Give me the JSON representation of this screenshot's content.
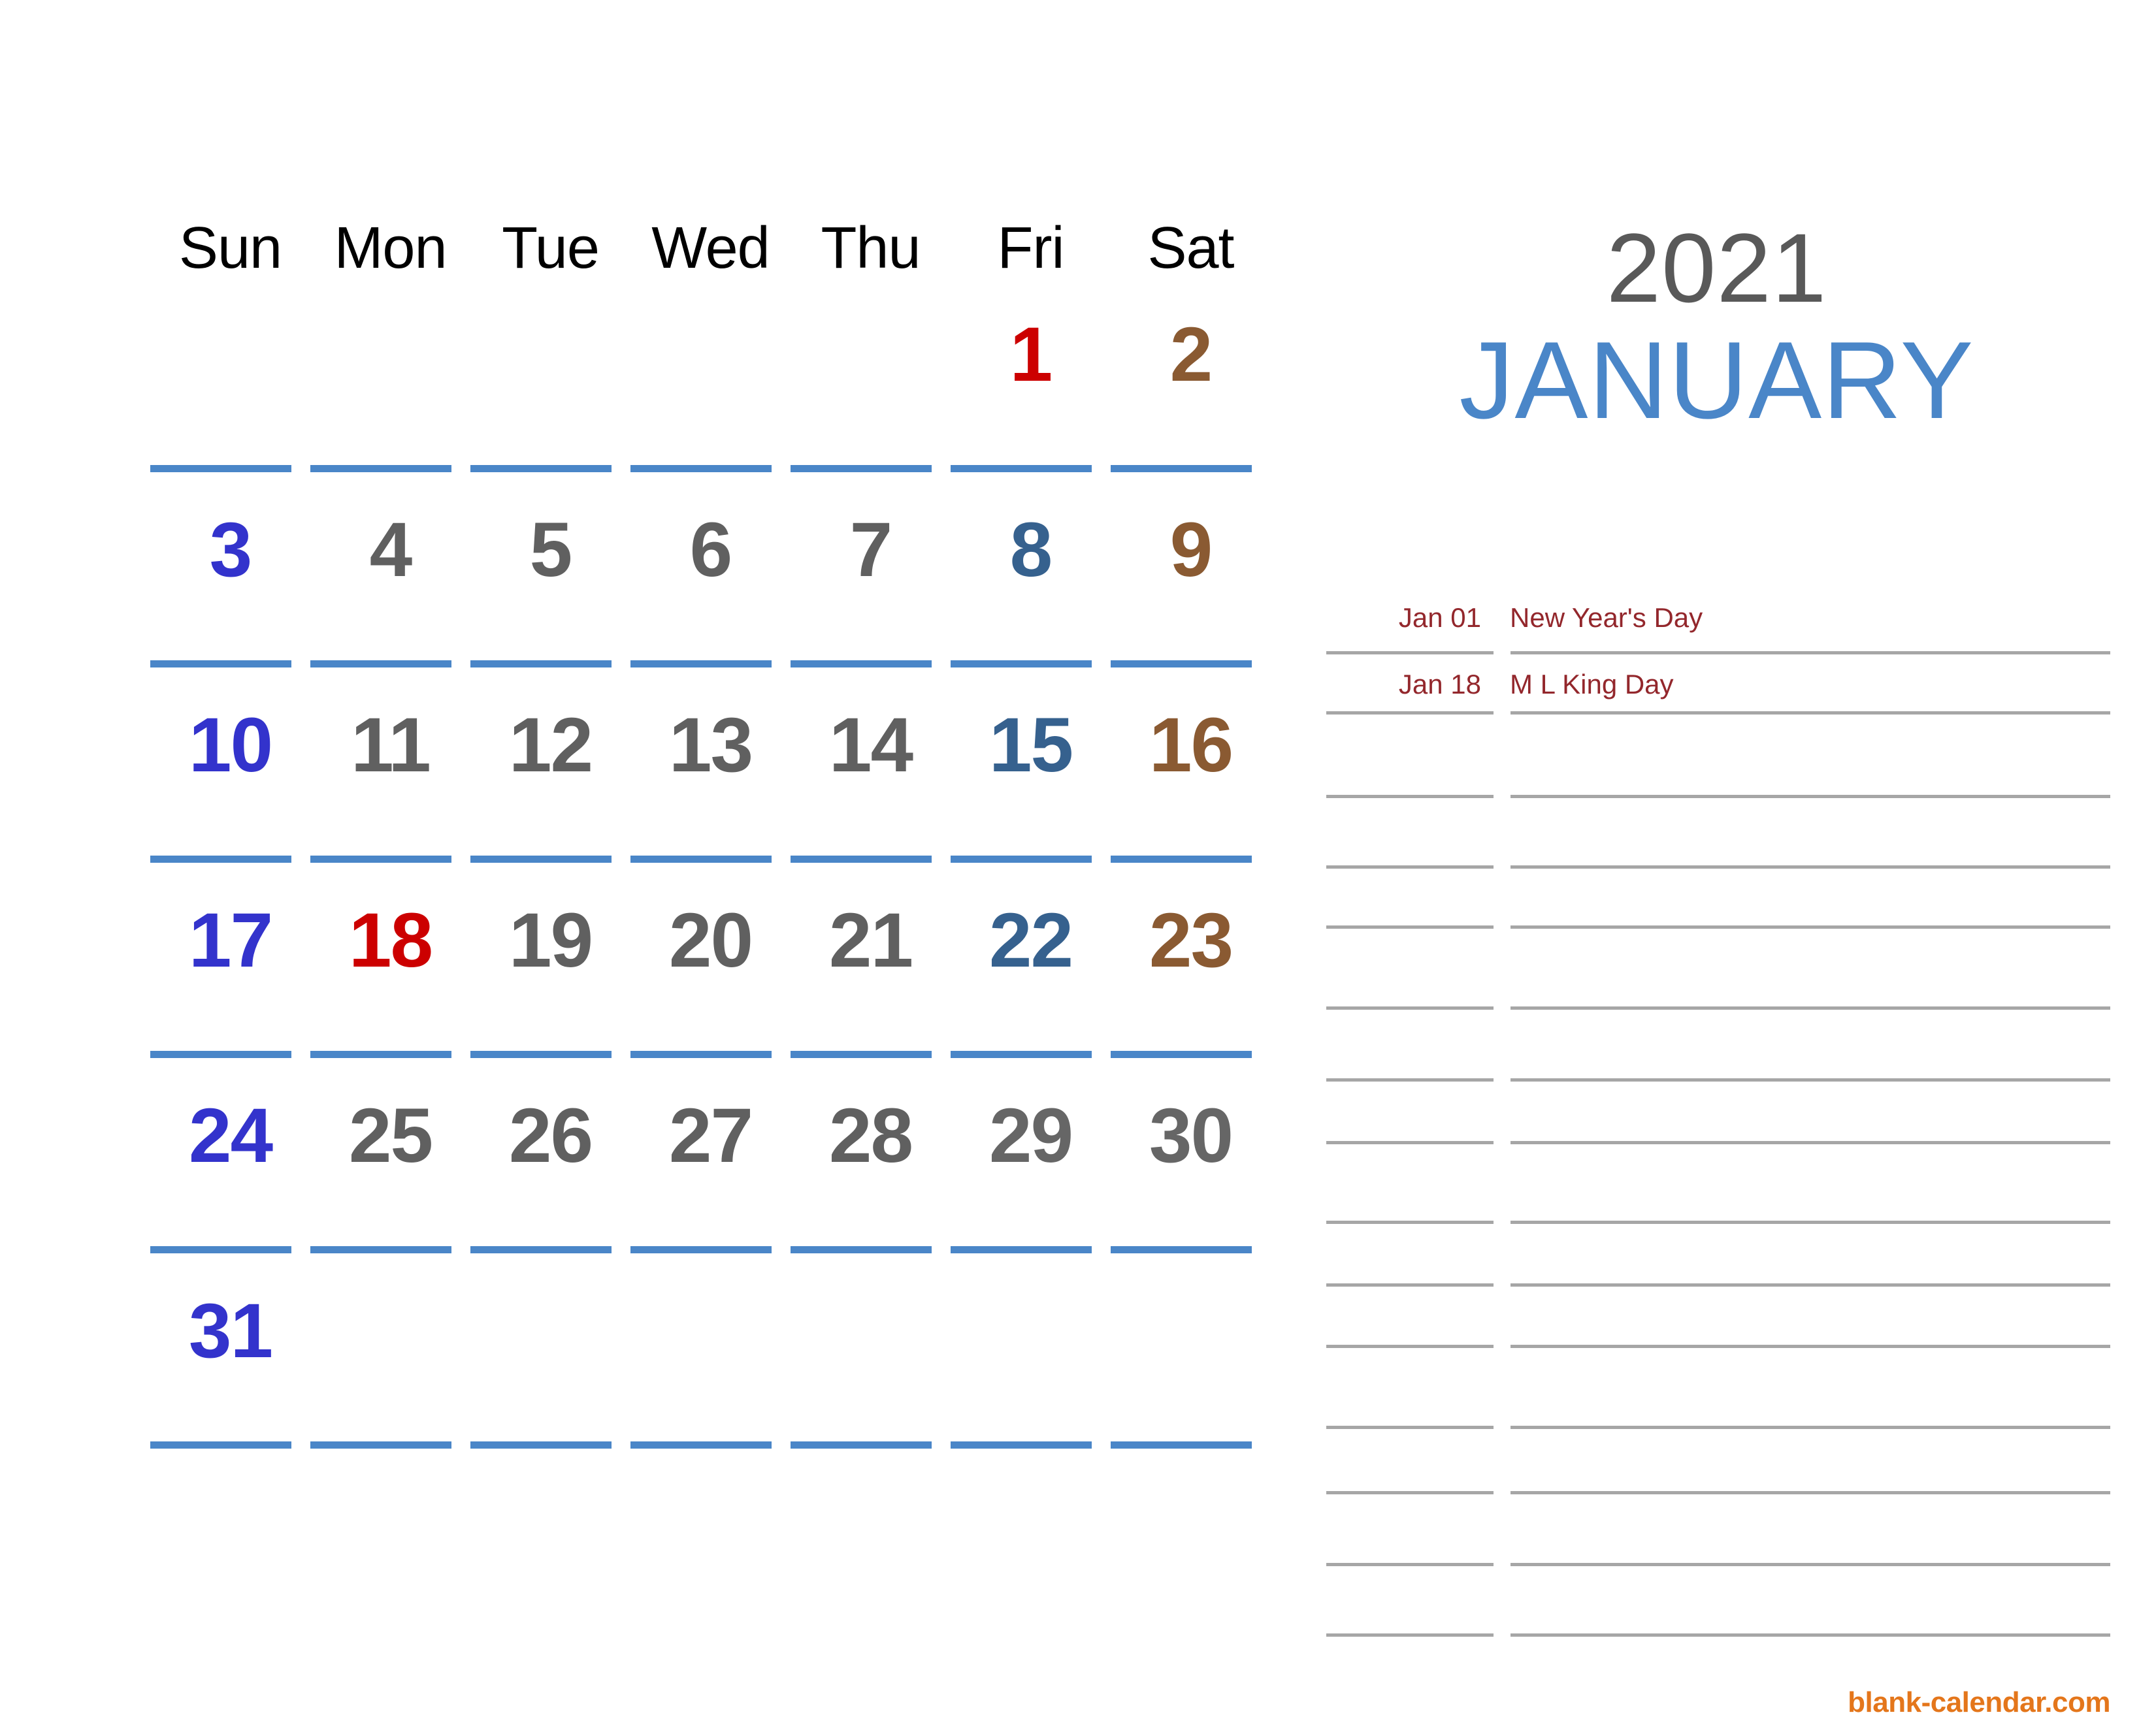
{
  "title": {
    "year": "2021",
    "month": "JANUARY"
  },
  "colors": {
    "sunday": "#3333cc",
    "weekday": "#606060",
    "friday": "#36618e",
    "saturday": "#8a5a32",
    "holiday": "#cc0000",
    "plain": "#666666",
    "month_accent": "#4a86c8",
    "year_gray": "#595959",
    "rule_blue": "#4a86c8",
    "rule_gray": "#a6a6a6",
    "note_red": "#93272c",
    "brand_orange": "#e4761b"
  },
  "weekdays": [
    "Sun",
    "Mon",
    "Tue",
    "Wed",
    "Thu",
    "Fri",
    "Sat"
  ],
  "weeks": [
    [
      {
        "day": "",
        "style": "c-week"
      },
      {
        "day": "",
        "style": "c-week"
      },
      {
        "day": "",
        "style": "c-week"
      },
      {
        "day": "",
        "style": "c-week"
      },
      {
        "day": "",
        "style": "c-week"
      },
      {
        "day": "1",
        "style": "c-holiday"
      },
      {
        "day": "2",
        "style": "c-sat"
      }
    ],
    [
      {
        "day": "3",
        "style": "c-sun"
      },
      {
        "day": "4",
        "style": "c-week"
      },
      {
        "day": "5",
        "style": "c-week"
      },
      {
        "day": "6",
        "style": "c-week"
      },
      {
        "day": "7",
        "style": "c-week"
      },
      {
        "day": "8",
        "style": "c-fri"
      },
      {
        "day": "9",
        "style": "c-sat"
      }
    ],
    [
      {
        "day": "10",
        "style": "c-sun"
      },
      {
        "day": "11",
        "style": "c-week"
      },
      {
        "day": "12",
        "style": "c-week"
      },
      {
        "day": "13",
        "style": "c-week"
      },
      {
        "day": "14",
        "style": "c-week"
      },
      {
        "day": "15",
        "style": "c-fri"
      },
      {
        "day": "16",
        "style": "c-sat"
      }
    ],
    [
      {
        "day": "17",
        "style": "c-sun"
      },
      {
        "day": "18",
        "style": "c-holiday"
      },
      {
        "day": "19",
        "style": "c-week"
      },
      {
        "day": "20",
        "style": "c-week"
      },
      {
        "day": "21",
        "style": "c-week"
      },
      {
        "day": "22",
        "style": "c-fri"
      },
      {
        "day": "23",
        "style": "c-sat"
      }
    ],
    [
      {
        "day": "24",
        "style": "c-sun"
      },
      {
        "day": "25",
        "style": "c-week"
      },
      {
        "day": "26",
        "style": "c-week"
      },
      {
        "day": "27",
        "style": "c-week"
      },
      {
        "day": "28",
        "style": "c-week"
      },
      {
        "day": "29",
        "style": "c-plain"
      },
      {
        "day": "30",
        "style": "c-plain"
      }
    ],
    [
      {
        "day": "31",
        "style": "c-sun"
      },
      {
        "day": "",
        "style": "c-week"
      },
      {
        "day": "",
        "style": "c-week"
      },
      {
        "day": "",
        "style": "c-week"
      },
      {
        "day": "",
        "style": "c-week"
      },
      {
        "day": "",
        "style": "c-week"
      },
      {
        "day": "",
        "style": "c-week"
      }
    ]
  ],
  "notes": {
    "rows": [
      {
        "date": "Jan 01",
        "label": "New Year's Day",
        "height": 112
      },
      {
        "date": "Jan 18",
        "label": "M L King Day",
        "height": 92
      },
      {
        "date": "",
        "label": "",
        "height": 128
      },
      {
        "date": "",
        "label": "",
        "height": 108
      },
      {
        "date": "",
        "label": "",
        "height": 92
      },
      {
        "date": "",
        "label": "",
        "height": 124
      },
      {
        "date": "",
        "label": "",
        "height": 110
      },
      {
        "date": "",
        "label": "",
        "height": 96
      },
      {
        "date": "",
        "label": "",
        "height": 122
      },
      {
        "date": "",
        "label": "",
        "height": 96
      },
      {
        "date": "",
        "label": "",
        "height": 94
      },
      {
        "date": "",
        "label": "",
        "height": 124
      },
      {
        "date": "",
        "label": "",
        "height": 100
      },
      {
        "date": "",
        "label": "",
        "height": 110
      },
      {
        "date": "",
        "label": "",
        "height": 108
      }
    ]
  },
  "footer": {
    "brand": "blank-calendar.com"
  }
}
